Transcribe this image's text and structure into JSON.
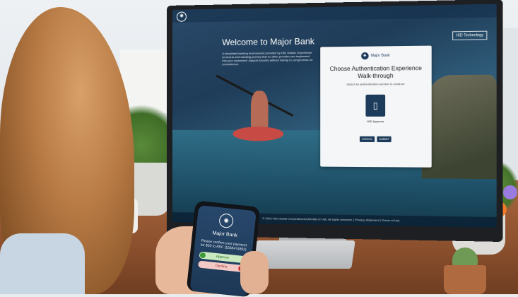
{
  "screen": {
    "badge": "HID Technology",
    "welcome_title": "Welcome to Major Bank",
    "intro_text": "A simulated banking environment provided by HID Global. Experience an end-to-end banking journey that no other provider can implement into your customers' support security without having to compromise on convenience.",
    "footer": "© 2023 HID Global Corporation/ASSA ABLOY AB. All rights reserved.  |  Privacy Statement  |  Terms of Use"
  },
  "card": {
    "brand": "Major Bank",
    "heading": "Choose Authentication Experience Walk-through",
    "subheading": "Select an authentication service to continue",
    "option_label": "HID Approve",
    "cancel_label": "CANCEL",
    "submit_label": "SUBMIT"
  },
  "phone": {
    "title": "Major Bank",
    "message": "Please confirm your payment for $50 to ABC (1838474892)",
    "approve_label": "Approve",
    "decline_label": "Decline"
  },
  "colors": {
    "brand_navy": "#1d3b5a",
    "approve_green": "#c9e9c0",
    "decline_red": "#f3c9c6"
  },
  "icons": {
    "logo": "bank-seal-icon",
    "option": "phone-approve-icon"
  }
}
